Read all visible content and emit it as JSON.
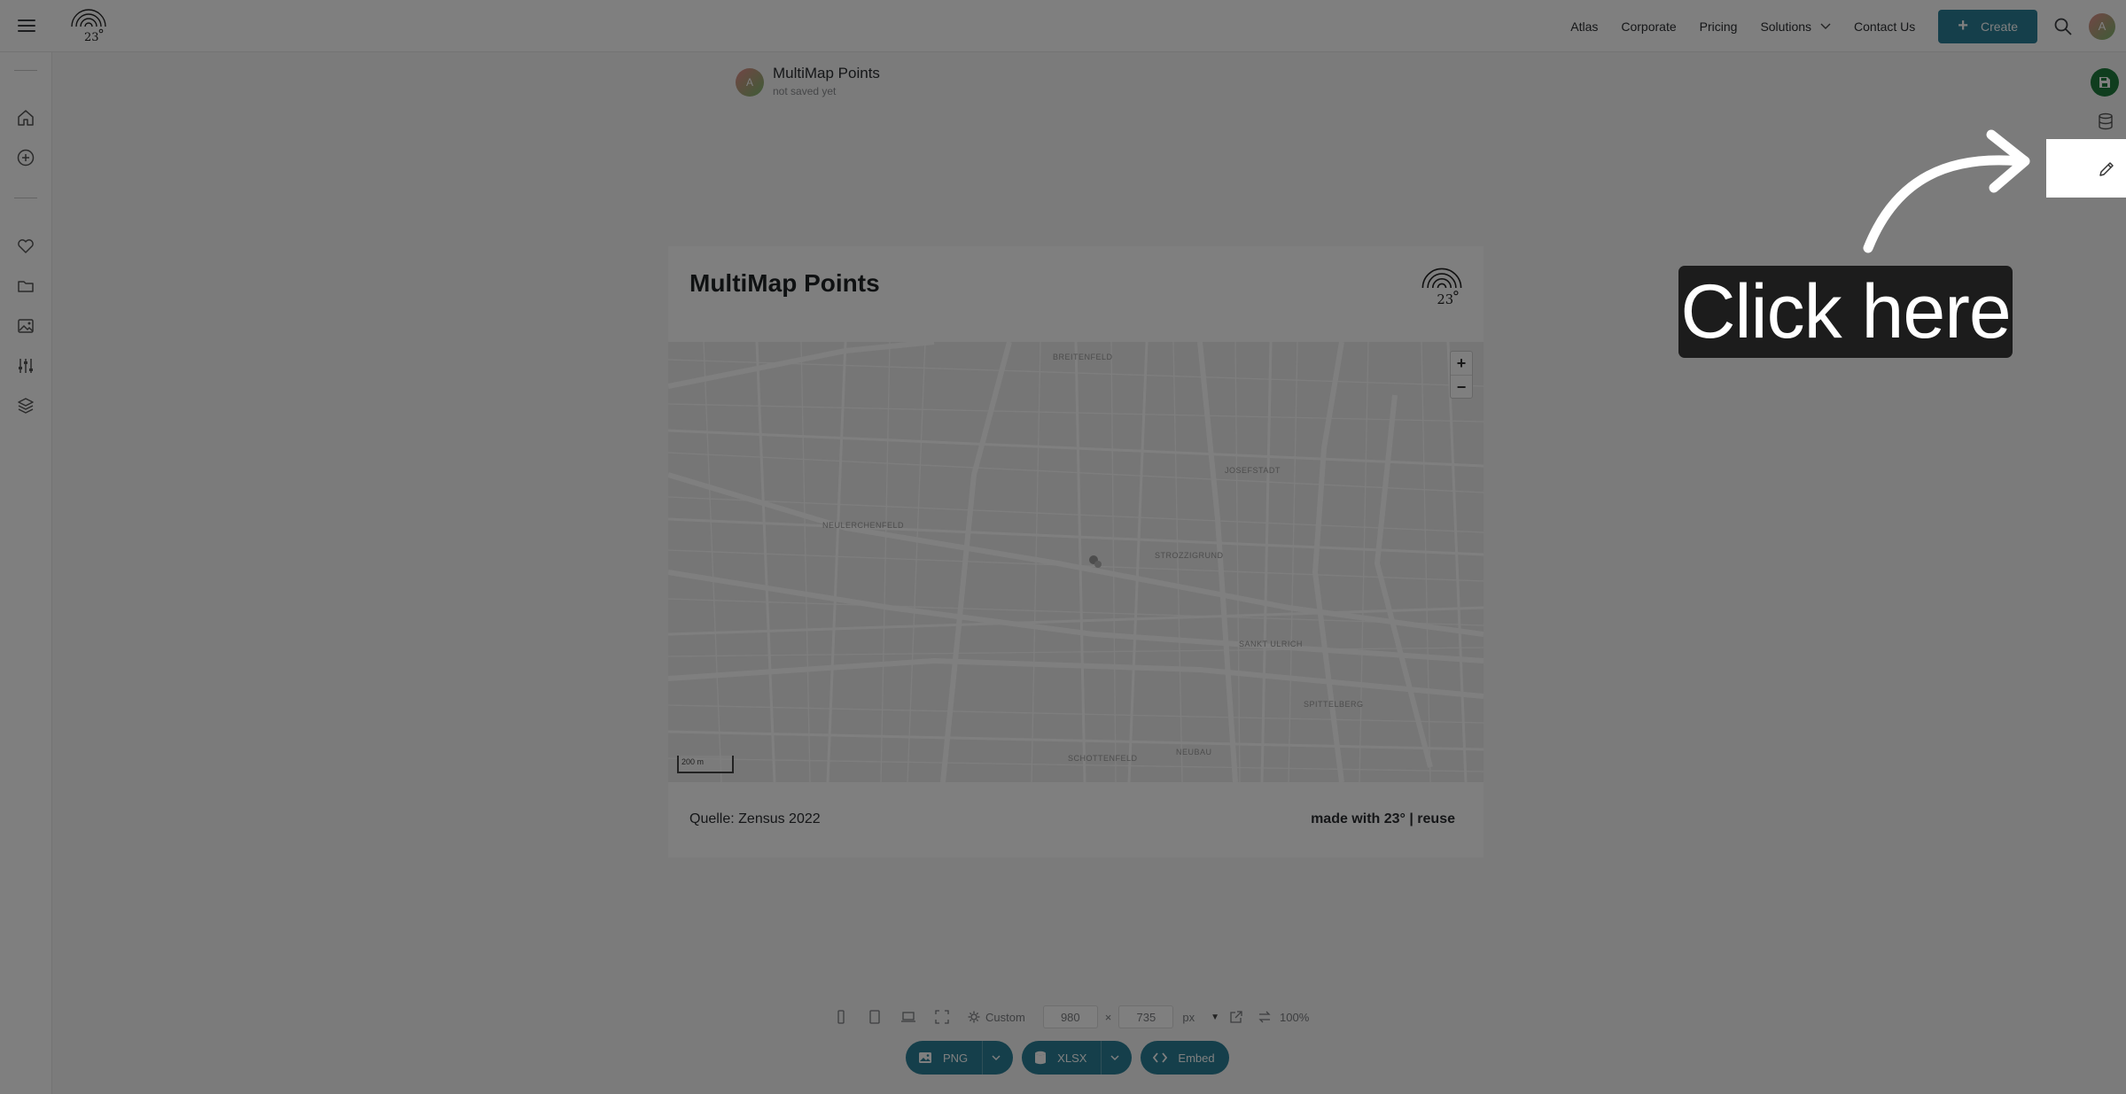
{
  "header": {
    "nav": [
      "Atlas",
      "Corporate",
      "Pricing"
    ],
    "solutions_label": "Solutions",
    "contact_label": "Contact Us",
    "create_label": "Create",
    "avatar_initial": "A"
  },
  "document": {
    "title": "MultiMap Points",
    "status": "not saved yet",
    "avatar_initial": "A"
  },
  "card": {
    "title": "MultiMap Points",
    "source": "Quelle: Zensus 2022",
    "credit": "made with 23° | reuse"
  },
  "map": {
    "zoom_in": "+",
    "zoom_out": "−",
    "scale_label": "200 m",
    "districts": [
      "BREITENFELD",
      "JOSEFSTADT",
      "NEULERCHENFELD",
      "STROZZIGRUND",
      "SANKT ULRICH",
      "SPITTELBERG",
      "SCHOTTENFELD",
      "NEUBAU"
    ]
  },
  "sizebar": {
    "preset_label": "Custom",
    "width_value": "980",
    "height_value": "735",
    "times": "×",
    "unit": "px",
    "zoom_level": "100%"
  },
  "export": {
    "png_label": "PNG",
    "xlsx_label": "XLSX",
    "embed_label": "Embed"
  },
  "overlay": {
    "callout_text": "Click here"
  },
  "colors": {
    "accent": "#2a7f96",
    "save": "#1e7a3c",
    "callout_bg": "#1c1c1c"
  },
  "icons": {
    "sidebar": [
      "home-icon",
      "add-circle-icon",
      "heart-icon",
      "folder-icon",
      "image-icon",
      "sliders-icon",
      "layers-icon"
    ],
    "rail": [
      "save-icon",
      "database-icon",
      "pencil-icon"
    ]
  }
}
